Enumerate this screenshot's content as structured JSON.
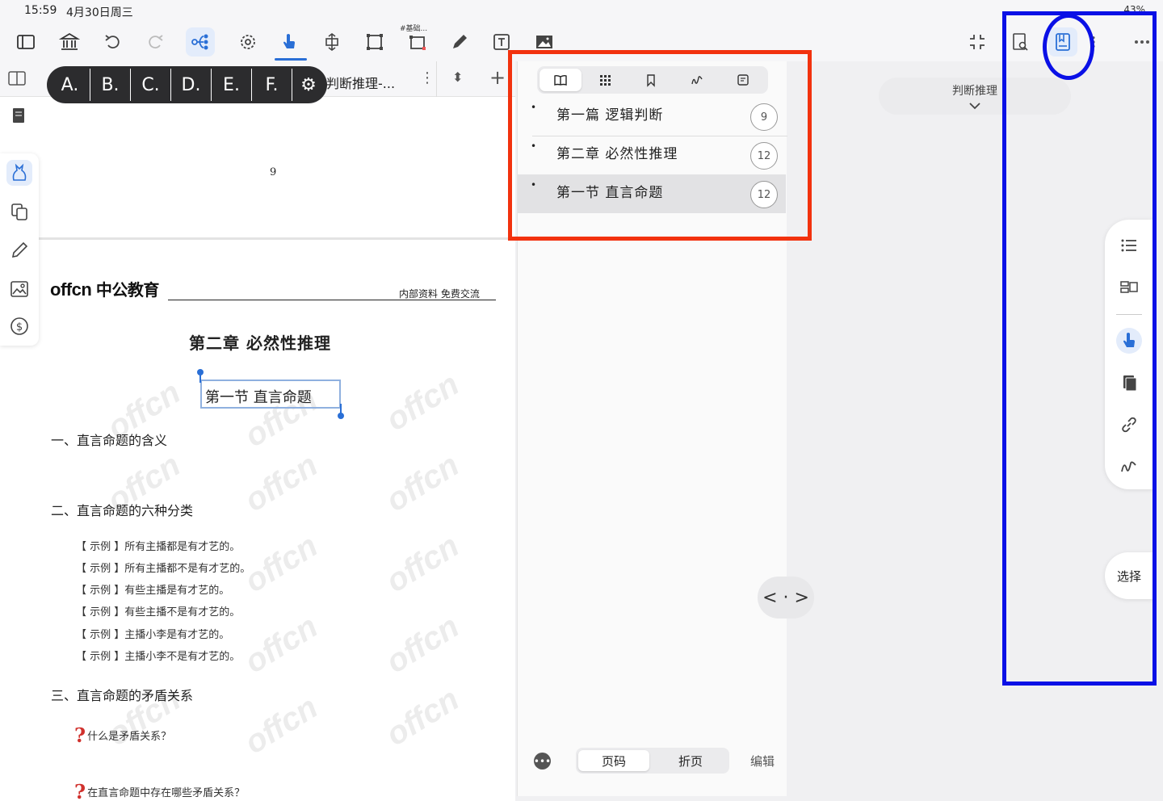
{
  "status_bar": {
    "time": "15:59",
    "date": "4月30日周三",
    "battery": "43%"
  },
  "toolbar": {
    "sub_label": "#基础...",
    "icons": [
      "sidebar-toggle-icon",
      "library-icon",
      "undo-icon",
      "redo-icon",
      "mindmap-icon",
      "lasso-icon",
      "hand-pointer-icon",
      "resize-icon",
      "frame-icon",
      "crop-frame-icon",
      "pen-icon",
      "text-box-icon",
      "image-icon",
      "collapse-icon",
      "search-doc-icon",
      "bookmark-icon",
      "more-vertical-icon",
      "more-horizontal-icon"
    ]
  },
  "doc": {
    "tab_title": "判断推理-...",
    "page_number": "9",
    "logo_latin": "offcn",
    "logo_cn": "中公教育",
    "header_note": "内部资料  免费交流",
    "chapter_title": "第二章    必然性推理",
    "section_title": "第一节    直言命题",
    "heading1": "一、直言命题的含义",
    "heading2": "二、直言命题的六种分类",
    "examples": [
      "【 示例 】所有主播都是有才艺的。",
      "【 示例 】所有主播都不是有才艺的。",
      "【 示例 】有些主播是有才艺的。",
      "【 示例 】有些主播不是有才艺的。",
      "【 示例 】主播小李是有才艺的。",
      "【 示例 】主播小李不是有才艺的。"
    ],
    "heading3": "三、直言命题的矛盾关系",
    "question1": "什么是矛盾关系？",
    "question2": "在直言命题中存在哪些矛盾关系？",
    "watermark": "offcn"
  },
  "letter_bar": {
    "letters": [
      "A.",
      "B.",
      "C.",
      "D.",
      "E.",
      "F."
    ]
  },
  "outline": {
    "items": [
      {
        "label": "第一篇  逻辑判断",
        "count": "9"
      },
      {
        "label": "第二章  必然性推理",
        "count": "12"
      },
      {
        "label": "第一节  直言命题",
        "count": "12"
      }
    ],
    "page_tab": "页码",
    "fold_tab": "折页",
    "edit": "编辑"
  },
  "right": {
    "breadcrumb": "判断推理",
    "nav": "< · >",
    "select": "选择"
  },
  "colors": {
    "accent": "#2a6fd6",
    "annotation_red": "#f2320e",
    "annotation_blue": "#0a10e6"
  }
}
